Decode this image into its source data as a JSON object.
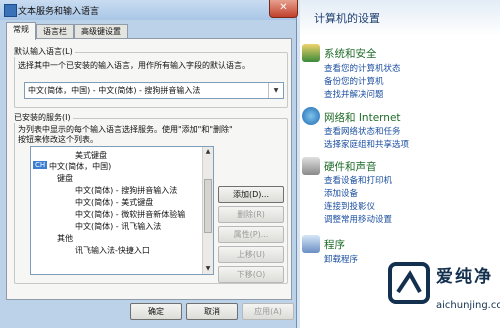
{
  "control_panel": {
    "title": "计算机的设置",
    "sections": [
      {
        "heading": "系统和安全",
        "links": [
          "查看您的计算机状态",
          "备份您的计算机",
          "查找并解决问题"
        ],
        "icon": "shield-icon"
      },
      {
        "heading": "网络和 Internet",
        "links": [
          "查看网络状态和任务",
          "选择家庭组和共享选项"
        ],
        "icon": "globe-icon"
      },
      {
        "heading": "硬件和声音",
        "links": [
          "查看设备和打印机",
          "添加设备",
          "连接到投影仪",
          "调整常用移动设置"
        ],
        "icon": "printer-icon"
      },
      {
        "heading": "程序",
        "links": [
          "卸载程序"
        ],
        "icon": "programs-icon"
      }
    ]
  },
  "dialog": {
    "title": "文本服务和输入语言",
    "close_label": "✕",
    "tabs": [
      "常规",
      "语言栏",
      "高级键设置"
    ],
    "default_lang": {
      "group_label": "默认输入语言(L)",
      "description": "选择其中一个已安装的输入语言，用作所有输入字段的默认语言。",
      "selected": "中文(简体，中国) - 中文(简体) - 搜狗拼音输入法"
    },
    "installed": {
      "group_label": "已安装的服务(I)",
      "desc_line1": "为列表中显示的每个输入语言选择服务。使用\"添加\"和\"删除\"",
      "desc_line2": "按钮来修改这个列表。",
      "tree": [
        "美式键盘",
        "中文(简体，中国)",
        "键盘",
        "中文(简体) - 搜狗拼音输入法",
        "中文(简体) - 美式键盘",
        "中文(简体) - 微软拼音新体验输",
        "中文(简体) - 讯飞输入法",
        "其他",
        "讯飞输入法-快捷入口"
      ],
      "lang_badge": "CH"
    },
    "side_buttons": [
      "添加(D)...",
      "删除(R)",
      "属性(P)...",
      "上移(U)",
      "下移(O)"
    ],
    "bottom_buttons": [
      "确定",
      "取消",
      "应用(A)"
    ]
  },
  "watermark": {
    "title": "爱纯净",
    "url": "aichunjing.com"
  }
}
